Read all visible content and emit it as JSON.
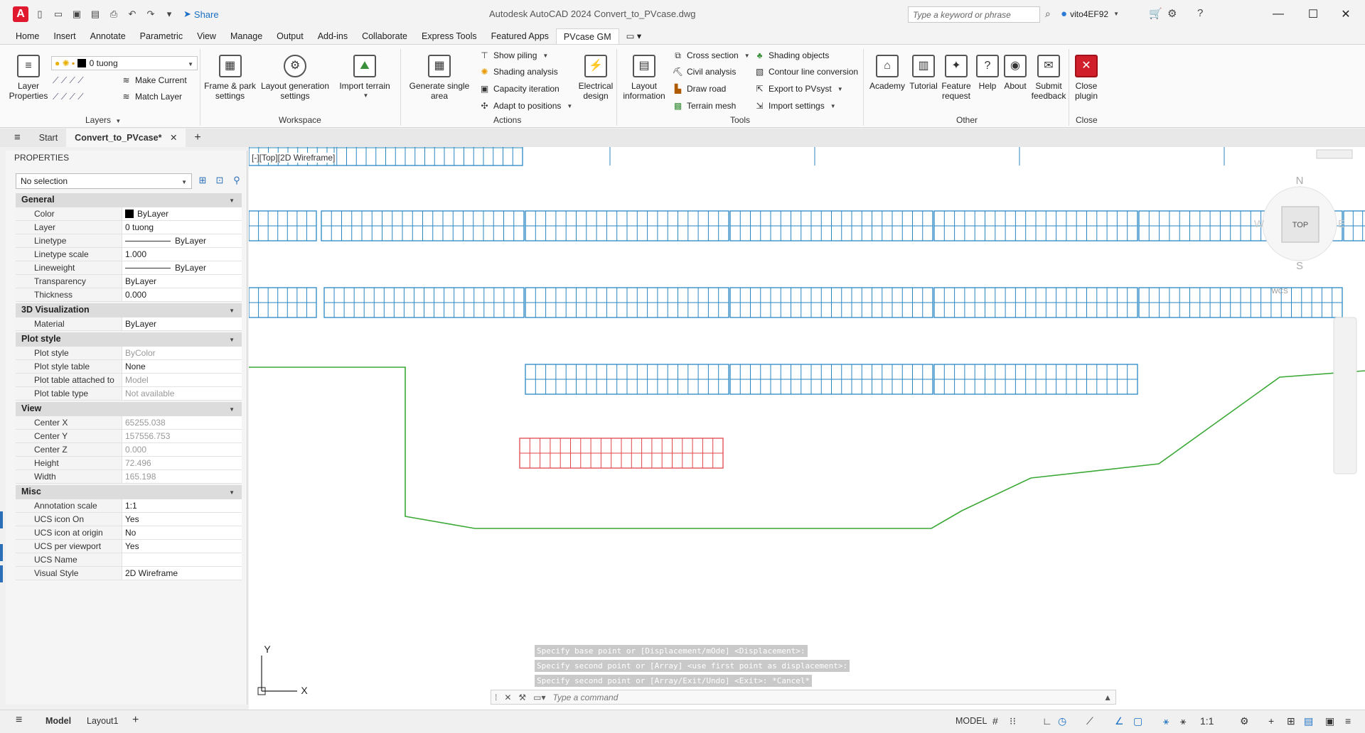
{
  "titlebar": {
    "app_letter": "A",
    "share_label": "Share",
    "title": "Autodesk AutoCAD 2024    Convert_to_PVcase.dwg",
    "search_placeholder": "Type a keyword or phrase",
    "user": "vito4EF92"
  },
  "ribbon_tabs": [
    "Home",
    "Insert",
    "Annotate",
    "Parametric",
    "View",
    "Manage",
    "Output",
    "Add-ins",
    "Collaborate",
    "Express Tools",
    "Featured Apps",
    "PVcase GM"
  ],
  "active_ribbon_tab": "PVcase GM",
  "ribbon": {
    "layers": {
      "title": "Layers",
      "layer_properties": "Layer Properties",
      "current_layer": "0 tuong",
      "make_current": "Make Current",
      "match_layer": "Match Layer"
    },
    "workspace": {
      "title": "Workspace",
      "frame_park": "Frame & park settings",
      "layout_generation": "Layout generation settings",
      "import_terrain": "Import terrain"
    },
    "actions": {
      "title": "Actions",
      "generate_single": "Generate single area",
      "show_piling": "Show piling",
      "shading_analysis": "Shading analysis",
      "capacity_iteration": "Capacity iteration",
      "adapt_positions": "Adapt to positions",
      "electrical_design": "Electrical design"
    },
    "tools": {
      "title": "Tools",
      "layout_information": "Layout information",
      "cross_section": "Cross section",
      "civil_analysis": "Civil analysis",
      "draw_road": "Draw road",
      "terrain_mesh": "Terrain mesh",
      "shading_objects": "Shading objects",
      "contour_conversion": "Contour line conversion",
      "export_pvsyst": "Export to PVsyst",
      "import_settings": "Import settings"
    },
    "other": {
      "title": "Other",
      "academy": "Academy",
      "tutorial": "Tutorial",
      "feature_request": "Feature request",
      "help": "Help",
      "about": "About",
      "submit_feedback": "Submit feedback"
    },
    "close": {
      "title": "Close",
      "close_plugin": "Close plugin"
    }
  },
  "doc_tabs": {
    "start": "Start",
    "active": "Convert_to_PVcase*"
  },
  "properties": {
    "title": "PROPERTIES",
    "selection": "No selection",
    "sections": [
      {
        "name": "General",
        "rows": [
          {
            "k": "Color",
            "v": "ByLayer"
          },
          {
            "k": "Layer",
            "v": "0 tuong"
          },
          {
            "k": "Linetype",
            "v": "ByLayer"
          },
          {
            "k": "Linetype scale",
            "v": "1.000"
          },
          {
            "k": "Lineweight",
            "v": "ByLayer"
          },
          {
            "k": "Transparency",
            "v": "ByLayer"
          },
          {
            "k": "Thickness",
            "v": "0.000"
          }
        ]
      },
      {
        "name": "3D Visualization",
        "rows": [
          {
            "k": "Material",
            "v": "ByLayer"
          }
        ]
      },
      {
        "name": "Plot style",
        "rows": [
          {
            "k": "Plot style",
            "v": "ByColor"
          },
          {
            "k": "Plot style table",
            "v": "None"
          },
          {
            "k": "Plot table attached to",
            "v": "Model"
          },
          {
            "k": "Plot table type",
            "v": "Not available"
          }
        ]
      },
      {
        "name": "View",
        "rows": [
          {
            "k": "Center X",
            "v": "65255.038"
          },
          {
            "k": "Center Y",
            "v": "157556.753"
          },
          {
            "k": "Center Z",
            "v": "0.000"
          },
          {
            "k": "Height",
            "v": "72.496"
          },
          {
            "k": "Width",
            "v": "165.198"
          }
        ]
      },
      {
        "name": "Misc",
        "rows": [
          {
            "k": "Annotation scale",
            "v": "1:1"
          },
          {
            "k": "UCS icon On",
            "v": "Yes"
          },
          {
            "k": "UCS icon at origin",
            "v": "No"
          },
          {
            "k": "UCS per viewport",
            "v": "Yes"
          },
          {
            "k": "UCS Name",
            "v": ""
          },
          {
            "k": "Visual Style",
            "v": "2D Wireframe"
          }
        ]
      }
    ]
  },
  "viewport": {
    "label": "[-][Top][2D Wireframe]",
    "viewcube": {
      "n": "N",
      "s": "S",
      "w": "W",
      "e": "E",
      "top": "TOP",
      "wcs": "WCS"
    },
    "ucs_x": "X",
    "ucs_y": "Y"
  },
  "command": {
    "history": [
      "Specify base point or [Displacement/mOde] <Displacement>:",
      "Specify second point or [Array] <use first point as displacement>:",
      "Specify second point or [Array/Exit/Undo] <Exit>: *Cancel*"
    ],
    "placeholder": "Type a command"
  },
  "status": {
    "model_tab": "Model",
    "layout_tab": "Layout1",
    "model_label": "MODEL",
    "scale": "1:1"
  },
  "colors": {
    "array_blue": "#2a87c2",
    "array_red": "#e0464a",
    "boundary_green": "#3aa835",
    "accent": "#1a6fc4"
  }
}
